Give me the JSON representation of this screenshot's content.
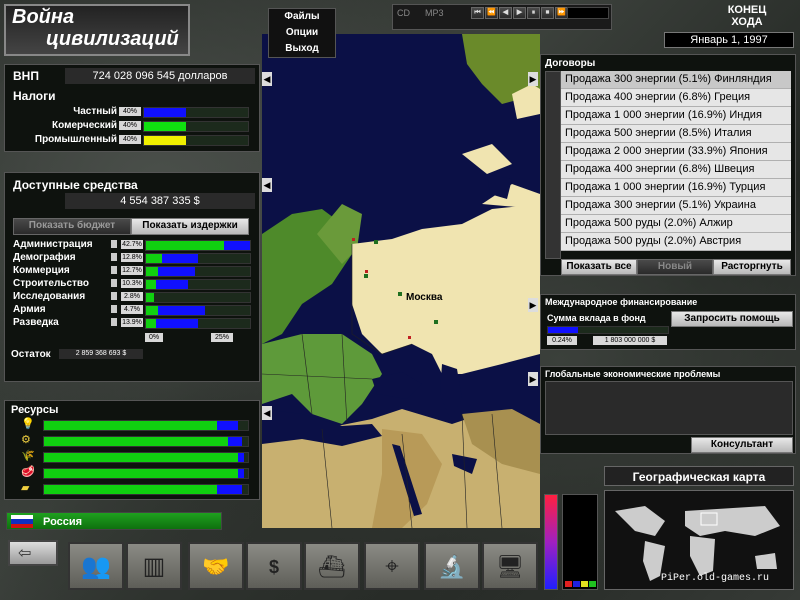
{
  "title": {
    "line1": "Война",
    "line2": "цивилизаций"
  },
  "menu": {
    "files": "Файлы",
    "options": "Опции",
    "exit": "Выход"
  },
  "media": {
    "cd": "CD",
    "mp3": "MP3",
    "controls": [
      "⏮",
      "⏪",
      "◀",
      "▶",
      "⏸",
      "⏹",
      "⏩",
      "⏭"
    ]
  },
  "turn": {
    "end_label_1": "КОНЕЦ",
    "end_label_2": "ХОДА",
    "date": "Январь 1, 1997"
  },
  "gnp": {
    "label": "ВНП",
    "value": "724 028 096 545 долларов"
  },
  "taxes": {
    "label": "Налоги",
    "items": [
      {
        "name": "Частный",
        "pct": "40%",
        "color": "#1010ff",
        "level": 0.4
      },
      {
        "name": "Комерческий",
        "pct": "40%",
        "color": "#10e010",
        "level": 0.4
      },
      {
        "name": "Промышленный",
        "pct": "40%",
        "color": "#f0f000",
        "level": 0.4
      }
    ]
  },
  "funds": {
    "label": "Доступные средства",
    "value": "4 554 387 335 $",
    "show_budget": "Показать бюджет",
    "show_costs": "Показать издержки",
    "items": [
      {
        "name": "Администрация",
        "pct": "42.7%",
        "green": 0.75,
        "blue": 0.25
      },
      {
        "name": "Демография",
        "pct": "12.8%",
        "green": 0.15,
        "blue": 0.35
      },
      {
        "name": "Коммерция",
        "pct": "12.7%",
        "green": 0.12,
        "blue": 0.35
      },
      {
        "name": "Строительство",
        "pct": "10.3%",
        "green": 0.1,
        "blue": 0.3
      },
      {
        "name": "Исследования",
        "pct": "2.8%",
        "green": 0.08,
        "blue": 0.0
      },
      {
        "name": "Армия",
        "pct": "4.7%",
        "green": 0.12,
        "blue": 0.45
      },
      {
        "name": "Разведка",
        "pct": "13.9%",
        "green": 0.1,
        "blue": 0.4
      }
    ],
    "scale_min": "0%",
    "scale_max": "25%",
    "remainder_label": "Остаток",
    "remainder_value": "2 859 368 693 $"
  },
  "resources": {
    "label": "Ресурсы",
    "items": [
      {
        "icon": "energy-icon",
        "glyph": "💡",
        "green": 0.85,
        "blue": 0.1
      },
      {
        "icon": "ore-icon",
        "glyph": "⚙",
        "green": 0.9,
        "blue": 0.07
      },
      {
        "icon": "grain-icon",
        "glyph": "🌾",
        "green": 0.95,
        "blue": 0.03
      },
      {
        "icon": "meat-icon",
        "glyph": "🥩",
        "green": 0.95,
        "blue": 0.03
      },
      {
        "icon": "gold-icon",
        "glyph": "▰",
        "green": 0.85,
        "blue": 0.12
      }
    ]
  },
  "country": {
    "name": "Россия"
  },
  "map": {
    "city": "Москва"
  },
  "treaties": {
    "label": "Договоры",
    "items": [
      "Продажа 300 энергии (5.1%) Финляндия",
      "Продажа 400 энергии (6.8%) Греция",
      "Продажа 1 000 энергии (16.9%) Индия",
      "Продажа 500 энергии (8.5%) Италия",
      "Продажа 2 000 энергии (33.9%) Япония",
      "Продажа 400 энергии (6.8%) Швеция",
      "Продажа 1 000 энергии (16.9%) Турция",
      "Продажа 300 энергии (5.1%) Украина",
      "Продажа 500 руды (2.0%) Алжир",
      "Продажа 500 руды (2.0%) Австрия"
    ],
    "show_all": "Показать все",
    "new": "Новый",
    "terminate": "Расторгнуть"
  },
  "finance": {
    "label": "Международное финансирование",
    "fund_label": "Сумма вклада в фонд",
    "request_help": "Запросить помощь",
    "pct": "0.24%",
    "amount": "1 803 000 000 $"
  },
  "problems": {
    "label": "Глобальные экономические проблемы",
    "consultant": "Консультант"
  },
  "geo_map": {
    "label": "Географическая карта"
  },
  "watermark": "PiPer.old-games.ru",
  "bottom_buttons": [
    "back-button",
    "population-button",
    "industry-button",
    "trade-button",
    "finance-button",
    "military-button",
    "intelligence-button",
    "research-button",
    "media-button"
  ]
}
